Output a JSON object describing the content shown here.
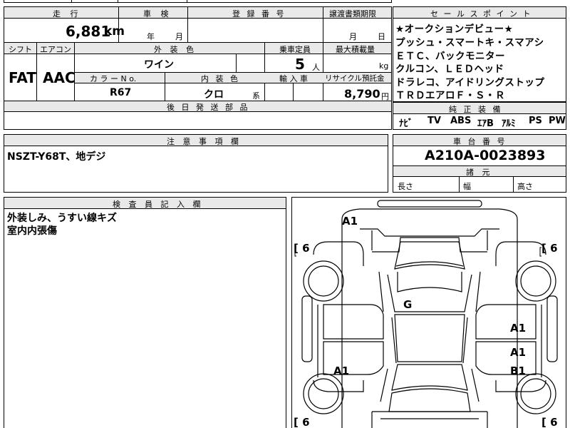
{
  "top": {
    "mileage_label": "走 行",
    "mileage_value": "6,881",
    "mileage_unit": "km",
    "inspection_label": "車 検",
    "inspection_year_unit": "年",
    "inspection_month_unit": "月",
    "registration_label": "登 録 番 号",
    "transfer_label": "譲渡書類期限",
    "transfer_month_unit": "月",
    "transfer_day_unit": "日"
  },
  "row2": {
    "shift_label": "シフト",
    "shift_value": "FAT",
    "aircon_label": "エアコン",
    "aircon_value": "AAC",
    "exterior_color_label": "外 装 色",
    "exterior_color_value": "ワイン",
    "capacity_label": "乗車定員",
    "capacity_value": "5",
    "capacity_unit": "人",
    "max_load_label": "最大積載量",
    "max_load_unit": "kg",
    "color_no_label": "カ ラ ー N o.",
    "color_no_value": "R67",
    "interior_color_label": "内 装 色",
    "interior_color_value": "クロ",
    "interior_color_suffix": "系",
    "import_label": "輸 入 車",
    "recycle_label": "リサイクル預託金",
    "recycle_value": "8,790",
    "recycle_unit": "円",
    "later_parts_label": "後 日 発 送 部 品"
  },
  "selling_points": {
    "label": "セ ー ル ス ポ イ ン ト",
    "lines": [
      "★オークションデビュー★",
      "プッシュ・スマートキ・スマアシ",
      "ＥＴＣ、バックモニター",
      "クルコン、ＬＥＤヘッド",
      "ドラレコ、アイドリングストップ",
      "ＴＲＤエアロＦ・Ｓ・Ｒ"
    ]
  },
  "equipment": {
    "label": "純 正 装 備",
    "items": [
      "ﾅﾋﾞ",
      "TV",
      "ABS",
      "ｴｱB",
      "ｱﾙﾐ",
      "PS",
      "PW"
    ]
  },
  "notes": {
    "label": "注 意 事 項 欄",
    "text": "NSZT-Y68T、地デジ"
  },
  "chassis": {
    "label": "車 台 番 号",
    "value": "A210A-0023893",
    "specs_label": "諸 元",
    "length_label": "長さ",
    "width_label": "幅",
    "height_label": "高さ"
  },
  "inspector": {
    "label": "検 査 員 記 入 欄",
    "lines": [
      "外装しみ、うすい線キズ",
      "室内内張傷"
    ]
  },
  "diagram": {
    "damage_labels": [
      "A1",
      "G",
      "A1",
      "A1",
      "A1",
      "B1"
    ],
    "tire_scores": [
      "[ 6",
      "[ 6",
      "[ 6",
      "[ 6"
    ]
  }
}
